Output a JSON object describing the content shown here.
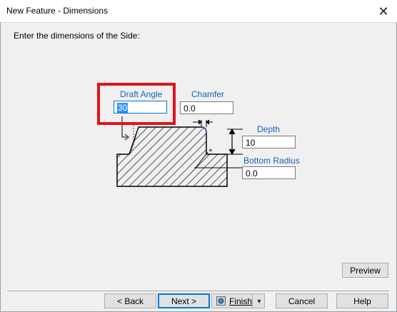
{
  "window": {
    "title": "New Feature - Dimensions",
    "close_glyph": "✕"
  },
  "instruction": "Enter the dimensions of the Side:",
  "fields": {
    "draft_angle": {
      "label": "Draft Angle",
      "value": "30"
    },
    "chamfer": {
      "label": "Chamfer",
      "value": "0.0"
    },
    "depth": {
      "label": "Depth",
      "value": "10"
    },
    "bottom_radius": {
      "label": "Bottom Radius",
      "value": "0.0"
    }
  },
  "buttons": {
    "preview": "Preview",
    "back": "< Back",
    "next": "Next >",
    "finish": "Finish",
    "cancel": "Cancel",
    "help": "Help"
  },
  "icons": {
    "close": "close-icon",
    "finish": "finish-icon",
    "dropdown": "dropdown-arrow-icon"
  },
  "colors": {
    "highlight": "#e0151c",
    "label_blue": "#1a5fb4",
    "focus_blue": "#0078d7"
  }
}
